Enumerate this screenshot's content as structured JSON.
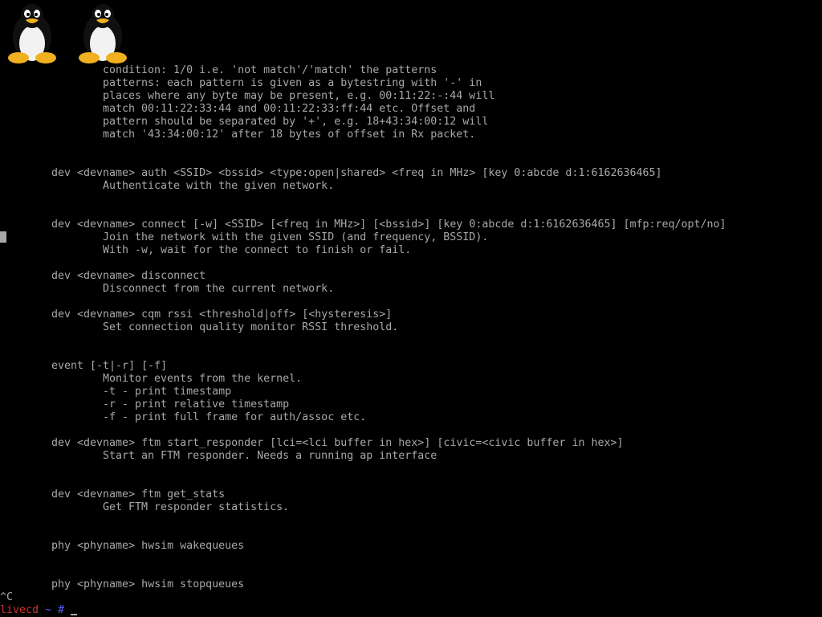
{
  "terminal": {
    "lines": [
      "condition: 1/0 i.e. 'not match'/'match' the patterns",
      "patterns: each pattern is given as a bytestring with '-' in",
      "places where any byte may be present, e.g. 00:11:22:-:44 will",
      "match 00:11:22:33:44 and 00:11:22:33:ff:44 etc. Offset and",
      "pattern should be separated by '+', e.g. 18+43:34:00:12 will",
      "match '43:34:00:12' after 18 bytes of offset in Rx packet.",
      "dev <devname> auth <SSID> <bssid> <type:open|shared> <freq in MHz> [key 0:abcde d:1:6162636465]",
      "Authenticate with the given network.",
      "dev <devname> connect [-w] <SSID> [<freq in MHz>] [<bssid>] [key 0:abcde d:1:6162636465] [mfp:req/opt/no]",
      "Join the network with the given SSID (and frequency, BSSID).",
      "With -w, wait for the connect to finish or fail.",
      "dev <devname> disconnect",
      "Disconnect from the current network.",
      "dev <devname> cqm rssi <threshold|off> [<hysteresis>]",
      "Set connection quality monitor RSSI threshold.",
      "event [-t|-r] [-f]",
      "Monitor events from the kernel.",
      "-t - print timestamp",
      "-r - print relative timestamp",
      "-f - print full frame for auth/assoc etc.",
      "dev <devname> ftm start_responder [lci=<lci buffer in hex>] [civic=<civic buffer in hex>]",
      "Start an FTM responder. Needs a running ap interface",
      "dev <devname> ftm get_stats",
      "Get FTM responder statistics.",
      "phy <phyname> hwsim wakequeues",
      "phy <phyname> hwsim stopqueues",
      "^C"
    ],
    "prompt": {
      "host": "livecd",
      "tilde": "~",
      "hash": "#"
    }
  },
  "colors": {
    "background": "#000000",
    "text": "#a8a8a8",
    "prompt_host": "#d43030",
    "prompt_path": "#5a5aff"
  },
  "icons": [
    "tux-penguin-icon",
    "tux-penguin-icon"
  ]
}
